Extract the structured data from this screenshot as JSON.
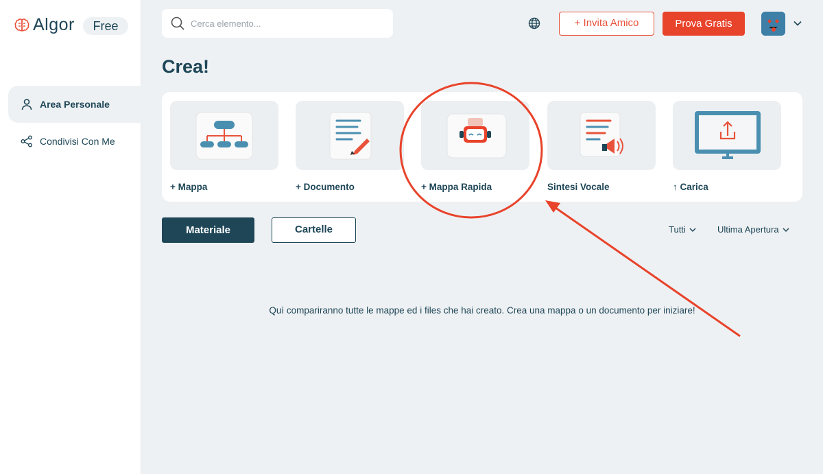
{
  "app": {
    "logo_text": "Algor",
    "plan_badge": "Free",
    "brand_color": "#e8432b",
    "primary_color": "#1e4657"
  },
  "sidebar": {
    "items": [
      {
        "label": "Area Personale",
        "icon": "user-icon",
        "active": true
      },
      {
        "label": "Condivisi Con Me",
        "icon": "share-icon",
        "active": false
      }
    ]
  },
  "header": {
    "search_placeholder": "Cerca elemento...",
    "language_icon": "globe-icon",
    "invite_label": "+ Invita Amico",
    "trial_label": "Prova Gratis",
    "avatar_icon": "emoji-avatar"
  },
  "main": {
    "title": "Crea!",
    "create_cards": [
      {
        "label": "+ Mappa",
        "icon": "concept-map-icon"
      },
      {
        "label": "+ Documento",
        "icon": "document-icon"
      },
      {
        "label": "+ Mappa Rapida",
        "icon": "robot-icon"
      },
      {
        "label": "Sintesi Vocale",
        "icon": "speech-synthesis-icon"
      },
      {
        "label": "↑ Carica",
        "icon": "upload-monitor-icon"
      }
    ],
    "tabs": [
      {
        "label": "Materiale",
        "active": true
      },
      {
        "label": "Cartelle",
        "active": false
      }
    ],
    "filters": {
      "type_label": "Tutti",
      "sort_label": "Ultima Apertura"
    },
    "empty_message": "Quì compariranno tutte le mappe ed i files che hai creato. Crea una mappa o un documento per iniziare!"
  }
}
